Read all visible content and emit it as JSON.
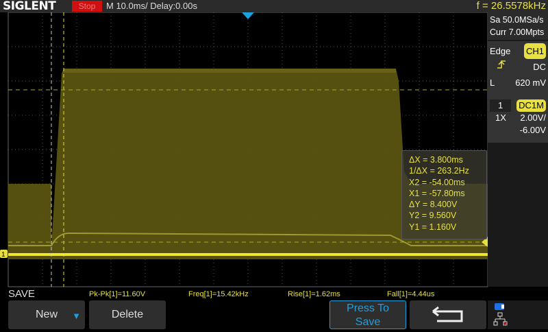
{
  "header": {
    "brand": "SIGLENT",
    "run_state": "Stop",
    "timebase": "M 10.0ms/ Delay:0.00s",
    "frequency": "f = 26.5578kHz"
  },
  "acquisition": {
    "sample_rate": "Sa 50.0MSa/s",
    "memory": "Curr 7.00Mpts"
  },
  "trigger": {
    "type": "Edge",
    "source": "CH1",
    "slope_icon": "rising-edge-icon",
    "coupling": "DC",
    "level_label": "L",
    "level": "620 mV"
  },
  "channel": {
    "number": "1",
    "coupling": "DC1M",
    "probe": "1X",
    "scale": "2.00V/",
    "offset": "-6.00V",
    "color": "#e8e040"
  },
  "cursors": [
    "ΔX = 3.800ms",
    "1/ΔX = 263.2Hz",
    "X2 = -54.00ms",
    "X1 = -57.80ms",
    "ΔY = 8.400V",
    "Y2 = 9.560V",
    "Y1 = 1.160V"
  ],
  "channel_marker": "1",
  "measurements": [
    "Pk-Pk[1]=11.60V",
    "Freq[1]=15.42kHz",
    "Rise[1]=1.62ms",
    "Fall[1]=4.44us"
  ],
  "menu": {
    "title": "SAVE",
    "buttons": {
      "new": "New",
      "delete": "Delete",
      "press_to_save_1": "Press To",
      "press_to_save_2": "Save"
    }
  }
}
